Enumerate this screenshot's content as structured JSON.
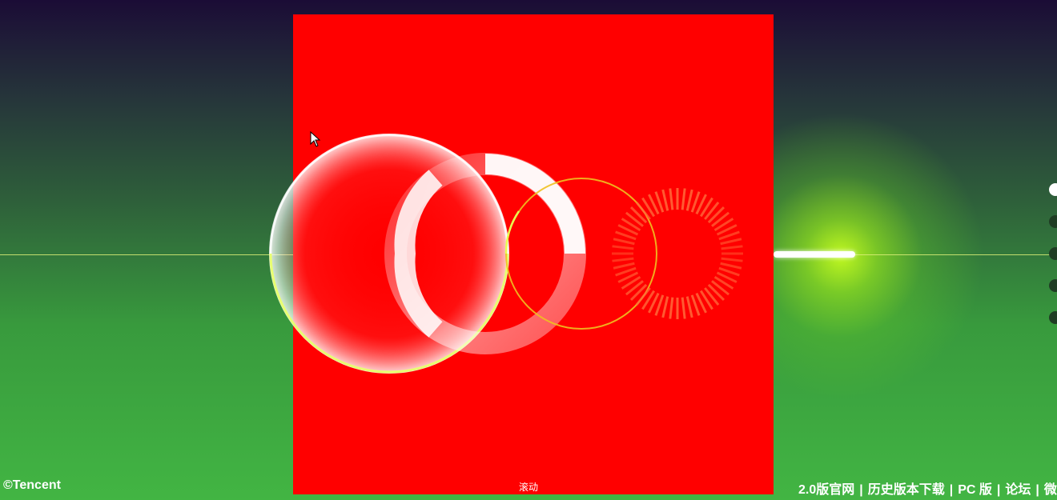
{
  "footer": {
    "copyright": "©Tencent",
    "links": [
      "2.0版官网",
      "历史版本下载",
      "PC 版",
      "论坛",
      "微博"
    ]
  },
  "scroll_hint": "滚动",
  "nav_dots": {
    "count": 5,
    "active_index": 0
  },
  "colors": {
    "stage": "#ff0000",
    "accent_glow": "#b6f01e",
    "ring_stroke": "#e8ff70"
  },
  "icons": [
    "cursor-icon"
  ]
}
